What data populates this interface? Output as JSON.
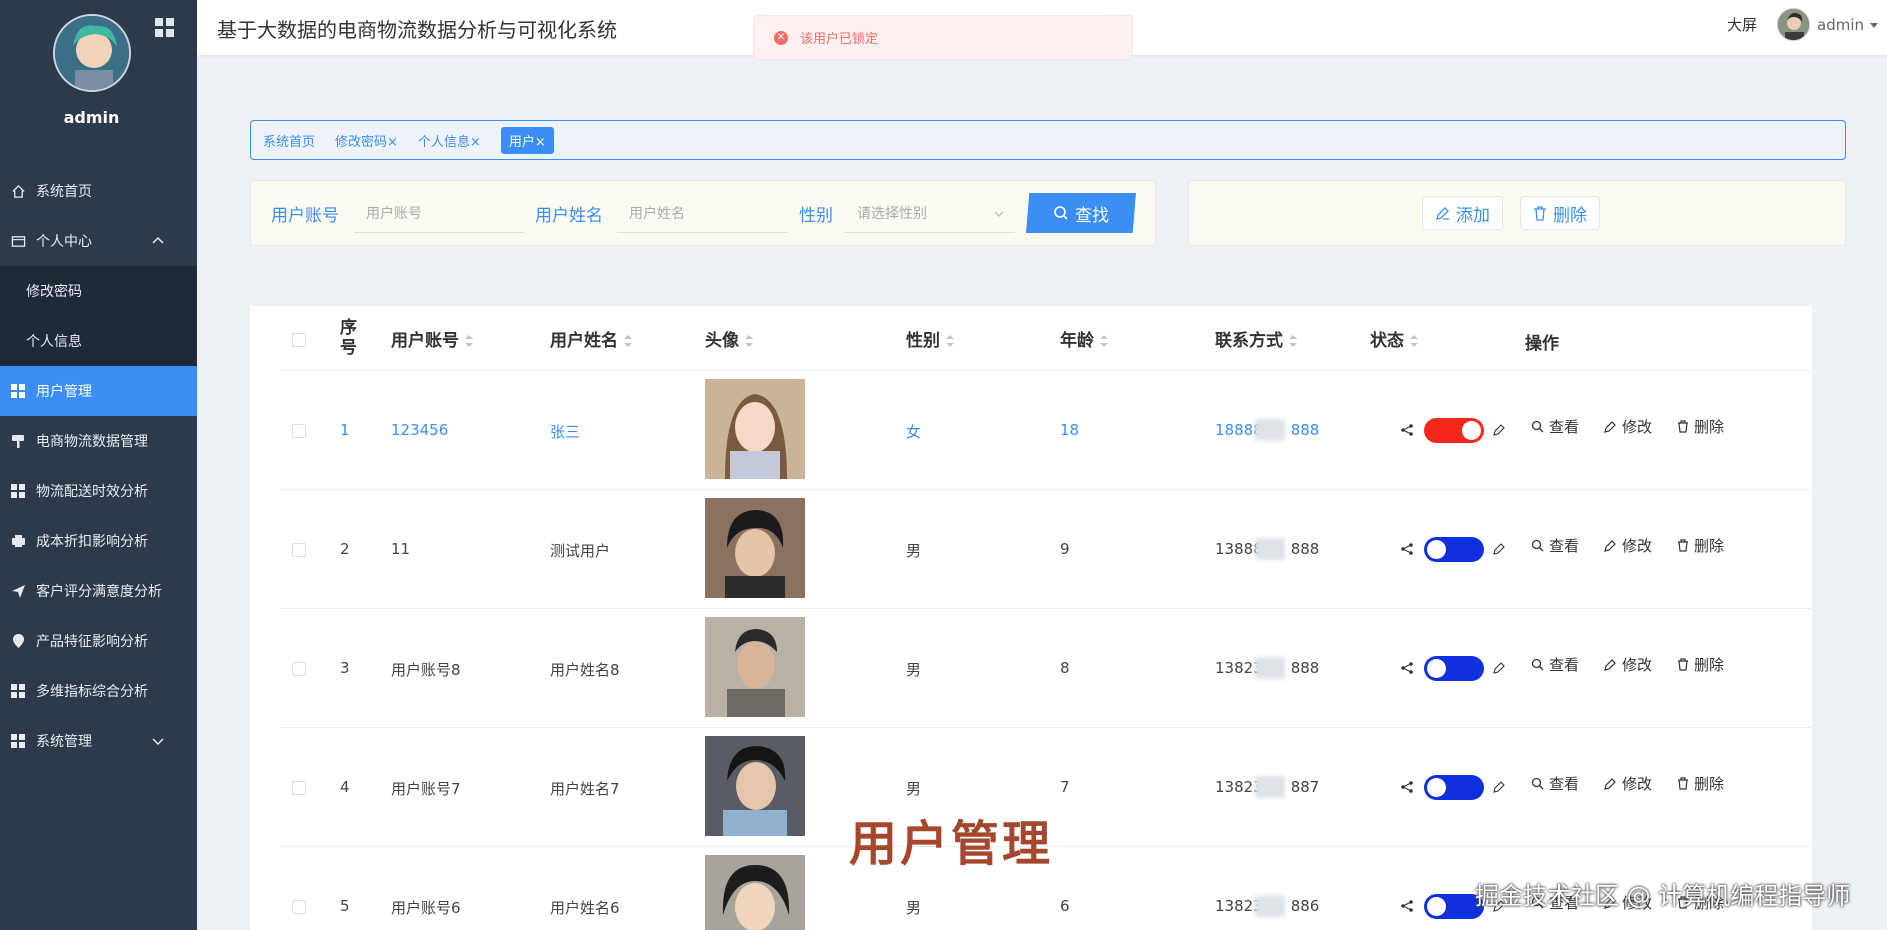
{
  "app": {
    "title": "基于大数据的电商物流数据分析与可视化系统",
    "big_screen": "大屏",
    "user": "admin"
  },
  "toast": {
    "message": "该用户已锁定",
    "icon": "error-icon"
  },
  "sidebar": {
    "username": "admin",
    "items": [
      {
        "label": "系统首页",
        "icon": "home-icon"
      },
      {
        "label": "个人中心",
        "icon": "folder-icon",
        "expanded": true
      },
      {
        "label": "修改密码",
        "sub": true
      },
      {
        "label": "个人信息",
        "sub": true
      },
      {
        "label": "用户管理",
        "icon": "grid-icon",
        "active": true
      },
      {
        "label": "电商物流数据管理",
        "icon": "paint-roller-icon"
      },
      {
        "label": "物流配送时效分析",
        "icon": "grid-icon"
      },
      {
        "label": "成本折扣影响分析",
        "icon": "printer-icon"
      },
      {
        "label": "客户评分满意度分析",
        "icon": "send-icon"
      },
      {
        "label": "产品特征影响分析",
        "icon": "location-pin-icon"
      },
      {
        "label": "多维指标综合分析",
        "icon": "grid-icon"
      },
      {
        "label": "系统管理",
        "icon": "grid-icon",
        "expanded": false
      }
    ]
  },
  "tags": [
    "系统首页",
    "修改密码",
    "个人信息",
    "用户"
  ],
  "tag_close": "×",
  "search": {
    "account_label": "用户账号",
    "account_placeholder": "用户账号",
    "name_label": "用户姓名",
    "name_placeholder": "用户姓名",
    "gender_label": "性别",
    "gender_placeholder": "请选择性别",
    "search_button": "查找"
  },
  "actions": {
    "add": "添加",
    "delete": "删除"
  },
  "table": {
    "headers": {
      "index": "序号",
      "account": "用户账号",
      "name": "用户姓名",
      "avatar": "头像",
      "gender": "性别",
      "age": "年龄",
      "phone": "联系方式",
      "status": "状态",
      "ops": "操作"
    },
    "rows": [
      {
        "index": "1",
        "account": "123456",
        "name": "张三",
        "gender": "女",
        "age": "18",
        "phone_start": "18888",
        "phone_end": "888",
        "status_on": true
      },
      {
        "index": "2",
        "account": "11",
        "name": "测试用户",
        "gender": "男",
        "age": "9",
        "phone_start": "13888",
        "phone_end": "888",
        "status_on": false
      },
      {
        "index": "3",
        "account": "用户账号8",
        "name": "用户姓名8",
        "gender": "男",
        "age": "8",
        "phone_start": "13823",
        "phone_end": "888",
        "status_on": false
      },
      {
        "index": "4",
        "account": "用户账号7",
        "name": "用户姓名7",
        "gender": "男",
        "age": "7",
        "phone_start": "13823",
        "phone_end": "887",
        "status_on": false
      },
      {
        "index": "5",
        "account": "用户账号6",
        "name": "用户姓名6",
        "gender": "男",
        "age": "6",
        "phone_start": "13823",
        "phone_end": "886",
        "status_on": false
      }
    ],
    "op_view": "查看",
    "op_edit": "修改",
    "op_delete": "删除"
  },
  "overlay": {
    "title": "用户管理",
    "credit": "掘金技术社区 @ 计算机编程指导师"
  },
  "colors": {
    "sidebar_bg": "#2d3a4b",
    "accent": "#3a8ef6",
    "toggle_on": "#f4271c",
    "toggle_off": "#1030e0",
    "toast_error": "#f56c6c"
  }
}
